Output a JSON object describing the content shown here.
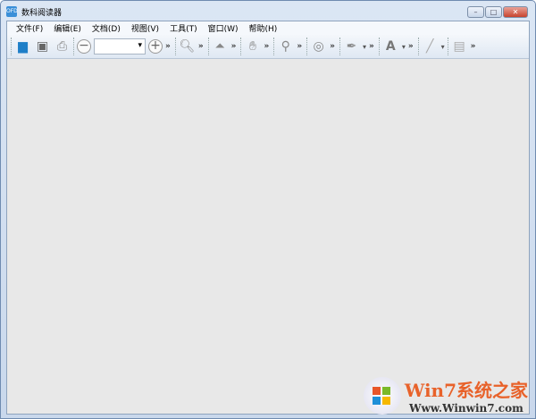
{
  "window": {
    "title": "数科阅读器",
    "controls": [
      "minimize",
      "maximize",
      "close"
    ]
  },
  "menu": [
    "文件(F)",
    "编辑(E)",
    "文档(D)",
    "视图(V)",
    "工具(T)",
    "窗口(W)",
    "帮助(H)"
  ],
  "toolbar": {
    "zoom_value": "",
    "more": "»"
  },
  "watermark": {
    "brand": "Win7系统之家",
    "url": "Www.Winwin7.com"
  }
}
